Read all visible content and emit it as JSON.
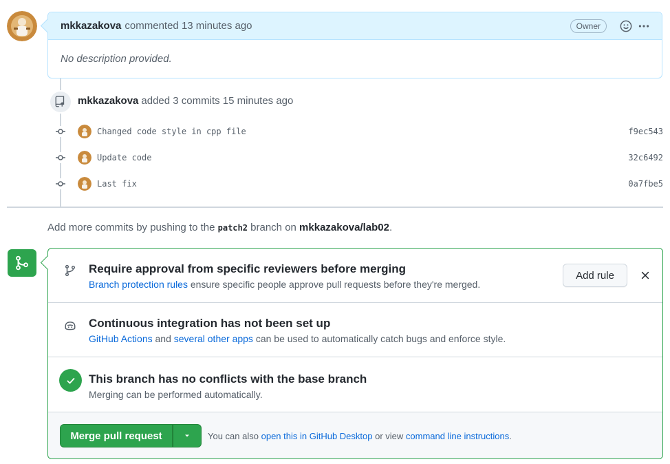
{
  "comment": {
    "author": "mkkazakova",
    "action": "commented 13 minutes ago",
    "badge": "Owner",
    "body": "No description provided."
  },
  "commits": {
    "author": "mkkazakova",
    "summary": "added 3 commits 15 minutes ago",
    "items": [
      {
        "message": "Changed code style in cpp file",
        "sha": "f9ec543"
      },
      {
        "message": "Update code",
        "sha": "32c6492"
      },
      {
        "message": "Last fix",
        "sha": "0a7fbe5"
      }
    ]
  },
  "push_note": {
    "prefix": "Add more commits by pushing to the",
    "branch": "patch2",
    "middle": "branch on",
    "repo": "mkkazakova/lab02",
    "suffix": "."
  },
  "merge": {
    "reviewers": {
      "title": "Require approval from specific reviewers before merging",
      "link": "Branch protection rules",
      "desc": "ensure specific people approve pull requests before they're merged.",
      "button": "Add rule"
    },
    "ci": {
      "title": "Continuous integration has not been set up",
      "link1": "GitHub Actions",
      "and": "and",
      "link2": "several other apps",
      "desc": "can be used to automatically catch bugs and enforce style."
    },
    "conflicts": {
      "title": "This branch has no conflicts with the base branch",
      "desc": "Merging can be performed automatically."
    },
    "footer": {
      "button": "Merge pull request",
      "prefix": "You can also",
      "link1": "open this in GitHub Desktop",
      "middle": "or view",
      "link2": "command line instructions",
      "suffix": "."
    }
  },
  "colors": {
    "green": "#2da44e",
    "blue_link": "#0969da",
    "header_bg": "#ddf4ff"
  }
}
